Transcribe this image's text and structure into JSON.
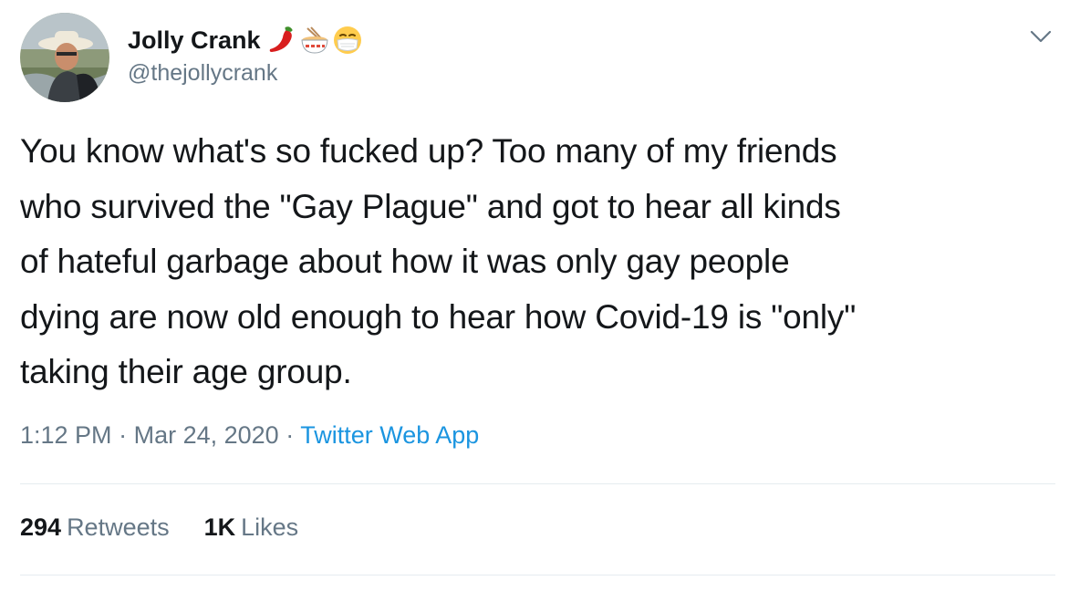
{
  "tweet": {
    "author": {
      "display_name": "Jolly Crank",
      "name_emojis": [
        "hot-pepper-icon",
        "noodle-bowl-icon",
        "face-with-mask-icon"
      ],
      "handle": "@thejollycrank",
      "avatar_icon": "avatar-photo"
    },
    "text": "You know what's so fucked up? Too many of my friends\nwho survived the \"Gay Plague\" and got to hear all kinds\nof hateful garbage about how it was only gay people\ndying are now old enough to hear how Covid-19 is \"only\"\ntaking their age group.",
    "time": "1:12 PM",
    "separator": "·",
    "date": "Mar 24, 2020",
    "source": "Twitter Web App",
    "stats": {
      "retweets_count": "294",
      "retweets_label": "Retweets",
      "likes_count": "1K",
      "likes_label": "Likes"
    },
    "menu_icon": "chevron-down-icon"
  },
  "colors": {
    "text_primary": "#14171a",
    "text_secondary": "#657786",
    "link": "#1b95e0",
    "divider": "#e6ecf0"
  }
}
